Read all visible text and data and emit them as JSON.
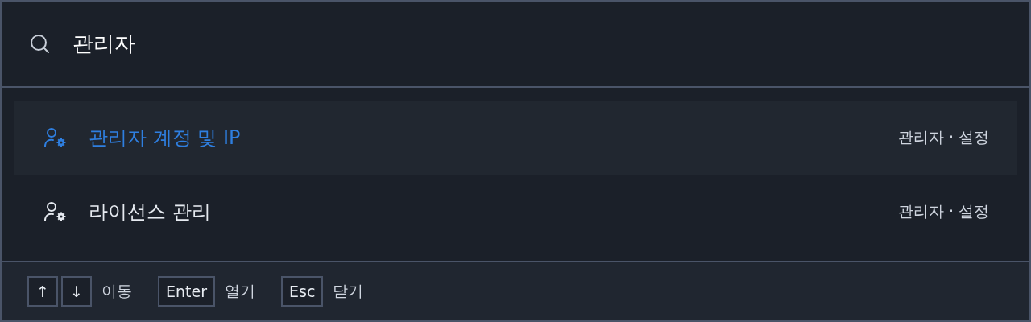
{
  "search": {
    "value": "관리자"
  },
  "results": [
    {
      "label": "관리자 계정 및 IP",
      "path": "관리자 · 설정",
      "selected": true
    },
    {
      "label": "라이선스 관리",
      "path": "관리자 · 설정",
      "selected": false
    }
  ],
  "footer_hints": [
    {
      "keys": [
        "↑",
        "↓"
      ],
      "label": "이동"
    },
    {
      "keys": [
        "Enter"
      ],
      "label": "열기"
    },
    {
      "keys": [
        "Esc"
      ],
      "label": "닫기"
    }
  ]
}
